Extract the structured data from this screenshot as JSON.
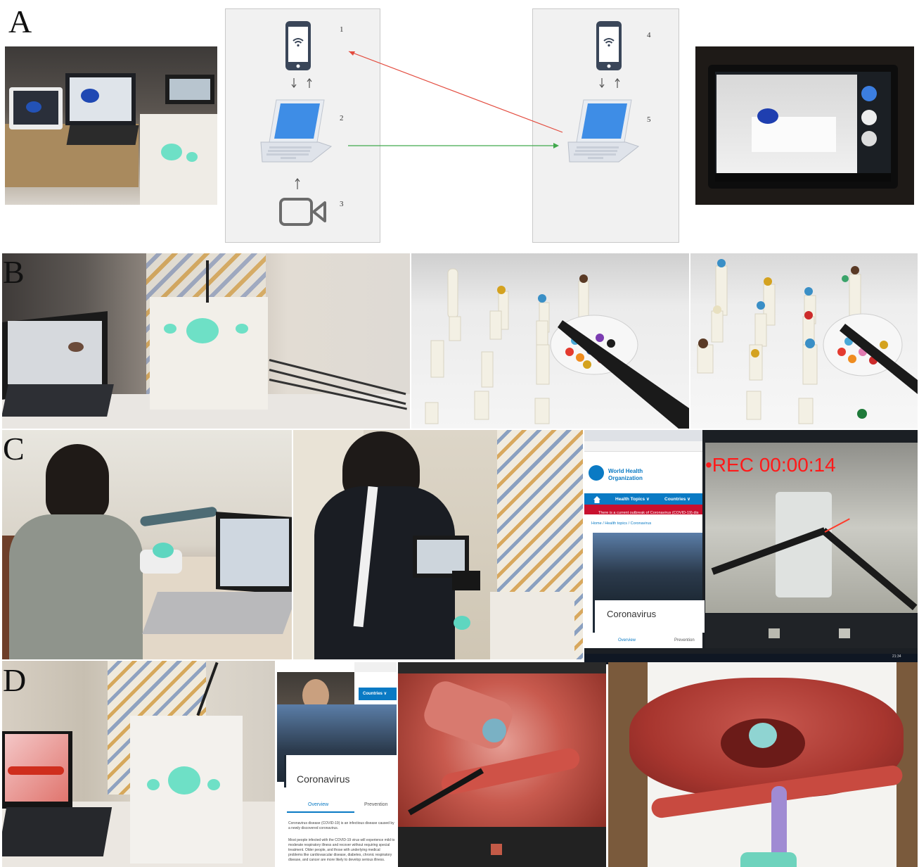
{
  "panels": {
    "a": {
      "letter": "A"
    },
    "b": {
      "letter": "B"
    },
    "c": {
      "letter": "C"
    },
    "d": {
      "letter": "D"
    }
  },
  "diagram": {
    "left_labels": [
      "1",
      "2",
      "3"
    ],
    "right_labels": [
      "4",
      "5"
    ]
  },
  "screen_c": {
    "rec": "•REC 00:00:14",
    "who_title": "World Health",
    "who_subtitle": "Organization",
    "nav_health_topics": "Health Topics ∨",
    "nav_countries": "Countries ∨",
    "alert": "There is a current outbreak of Coronavirus (COVID-19) dis",
    "breadcrumb": "Home / Health topics / Coronavirus",
    "heading": "Coronavirus",
    "tab_overview": "Overview",
    "tab_prevention": "Prevention",
    "clock": "21:34"
  },
  "screen_d": {
    "countries": "Countries ∨",
    "heading": "Coronavirus",
    "tab_overview": "Overview",
    "tab_prevention": "Prevention",
    "body1": "Coronavirus disease (COVID-19) is an infectious disease caused by a newly discovered coronavirus.",
    "body2": "Most people infected with the COVID-19 virus will experience mild to moderate respiratory illness and recover without requiring special treatment. Older people, and those with underlying medical problems like cardiovascular disease, diabetes, chronic respiratory disease, and cancer are more likely to develop serious illness."
  },
  "colors": {
    "red_arrow": "#e34b3e",
    "green_arrow": "#41a94d",
    "icon_dark": "#3a4659",
    "laptop_blue": "#3e8de6",
    "who_blue": "#0a7ac4",
    "alert_red": "#c8102e",
    "rec_red": "#ff1a1a"
  }
}
